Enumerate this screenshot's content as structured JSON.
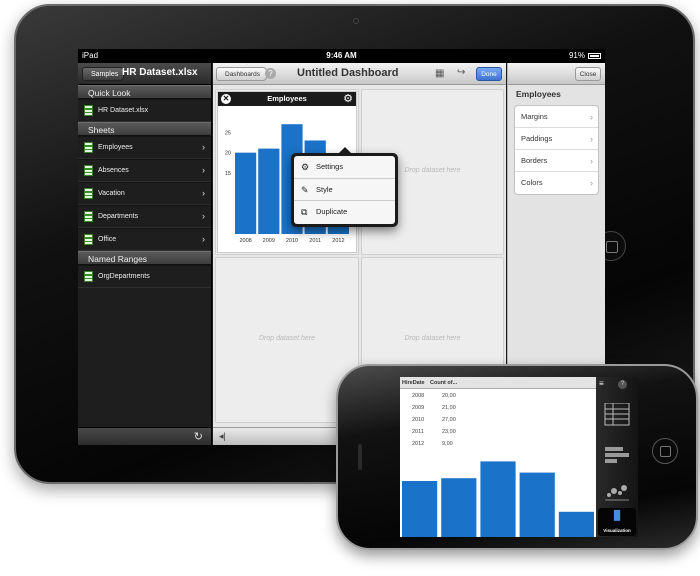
{
  "ipad": {
    "status": {
      "carrier": "iPad",
      "time": "9:46 AM",
      "battery": "91%"
    },
    "sidebar": {
      "back_label": "Samples",
      "file_title": "HR Dataset.xlsx",
      "quick_look_header": "Quick Look",
      "quick_look_items": [
        {
          "label": "HR Dataset.xlsx"
        }
      ],
      "sheets_header": "Sheets",
      "sheets": [
        {
          "label": "Employees"
        },
        {
          "label": "Absences"
        },
        {
          "label": "Vacation"
        },
        {
          "label": "Departments"
        },
        {
          "label": "Office"
        }
      ],
      "named_ranges_header": "Named Ranges",
      "named_ranges": [
        {
          "label": "OrgDepartments"
        }
      ],
      "refresh_icon": "refresh-icon"
    },
    "dashboard": {
      "back_label": "Dashboards",
      "help_glyph": "?",
      "title": "Untitled Dashboard",
      "done_label": "Done",
      "drop_text": "Drop dataset here",
      "widget_title": "Employees",
      "popup_menu": [
        {
          "label": "Settings",
          "icon": "settings-icon"
        },
        {
          "label": "Style",
          "icon": "brush-icon"
        },
        {
          "label": "Duplicate",
          "icon": "duplicate-icon"
        }
      ]
    },
    "right_panel": {
      "close_label": "Close",
      "title": "Employees",
      "items": [
        {
          "label": "Margins"
        },
        {
          "label": "Paddings"
        },
        {
          "label": "Borders"
        },
        {
          "label": "Colors"
        }
      ]
    }
  },
  "iphone": {
    "table": {
      "headers": [
        "HireDate",
        "Count of..."
      ],
      "rows": [
        [
          "2008",
          "20,00"
        ],
        [
          "2009",
          "21,00"
        ],
        [
          "2010",
          "27,00"
        ],
        [
          "2011",
          "23,00"
        ],
        [
          "2012",
          "9,00"
        ]
      ]
    },
    "tab_label": "Visualization",
    "accent": "#1a73c8"
  },
  "chart_data": [
    {
      "type": "bar",
      "title": "Employees",
      "categories": [
        "2008",
        "2009",
        "2010",
        "2011",
        "2012"
      ],
      "values": [
        20,
        21,
        27,
        23,
        9
      ],
      "ytick_labels": [
        "15",
        "20",
        "25"
      ],
      "ylim": [
        0,
        30
      ],
      "color": "#1a73c8"
    },
    {
      "type": "bar",
      "categories": [
        "2008",
        "2009",
        "2010",
        "2011",
        "2012"
      ],
      "values": [
        20,
        21,
        27,
        23,
        9
      ],
      "ylim": [
        0,
        30
      ],
      "color": "#1a73c8"
    }
  ]
}
